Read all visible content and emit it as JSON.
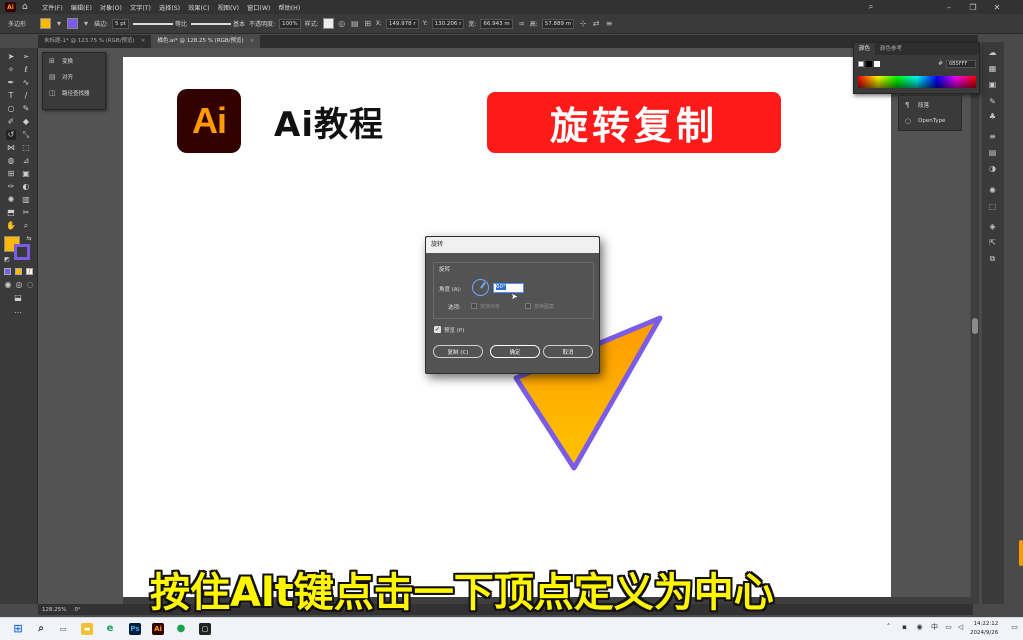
{
  "menubar": {
    "logo_text": "Ai",
    "items": [
      "文件(F)",
      "编辑(E)",
      "对象(O)",
      "文字(T)",
      "选择(S)",
      "效果(C)",
      "视图(V)",
      "窗口(W)",
      "帮助(H)"
    ]
  },
  "controlbar": {
    "object_type": "多边形",
    "stroke_label": "描边:",
    "stroke_weight": "5 pt",
    "profile_label": "等比",
    "brush_label": "基本",
    "opacity_label": "不透明度:",
    "opacity_value": "100%",
    "style_label": "样式:",
    "x_label": "X:",
    "x_value": "149.978 r",
    "y_label": "Y:",
    "y_value": "130.206 r",
    "w_label": "宽:",
    "w_value": "66.943 m",
    "h_label": "高:",
    "h_value": "57.889 m"
  },
  "tabs": [
    {
      "label": "未标题-1* @ 123.75 % (RGB/预览)",
      "active": false
    },
    {
      "label": "橘色.ai* @ 128.25 % (RGB/预览)",
      "active": true
    }
  ],
  "flyout": {
    "items": [
      "变换",
      "对齐",
      "路径查找器"
    ]
  },
  "artboard": {
    "logo_text": "Ai",
    "heading": "Ai教程",
    "banner": "旋转复制"
  },
  "dialog": {
    "title": "旋转",
    "section": "旋转",
    "angle_label": "角度 (A):",
    "angle_value": "60°",
    "options_label": "选项:",
    "option_objects": "变换对象",
    "option_patterns": "变换图案",
    "preview_label": "预览 (P)",
    "copy_button": "复制 (C)",
    "ok_button": "确定",
    "cancel_button": "取消"
  },
  "color_panel": {
    "tab_color": "颜色",
    "tab_guide": "颜色参考",
    "hex": "6B5FFF"
  },
  "char_panel": {
    "items": [
      "段落",
      "OpenType"
    ]
  },
  "statusbar": {
    "zoom": "128.25%",
    "rotation": "0°"
  },
  "subtitle": "按住Alt键点击一下顶点定义为中心",
  "taskbar": {
    "time": "14:22:12",
    "date": "2024/9/26",
    "ai_label": "Ai",
    "ps_label": "Ps"
  },
  "colors": {
    "brand_ai_bg": "#330000",
    "brand_ai_fg": "#ff9a00",
    "banner_red": "#ff1a1a",
    "subtitle_yellow": "#fff600",
    "triangle_top": "#ff9a00",
    "triangle_bottom": "#ffc400",
    "triangle_stroke": "#7b5ce8"
  }
}
